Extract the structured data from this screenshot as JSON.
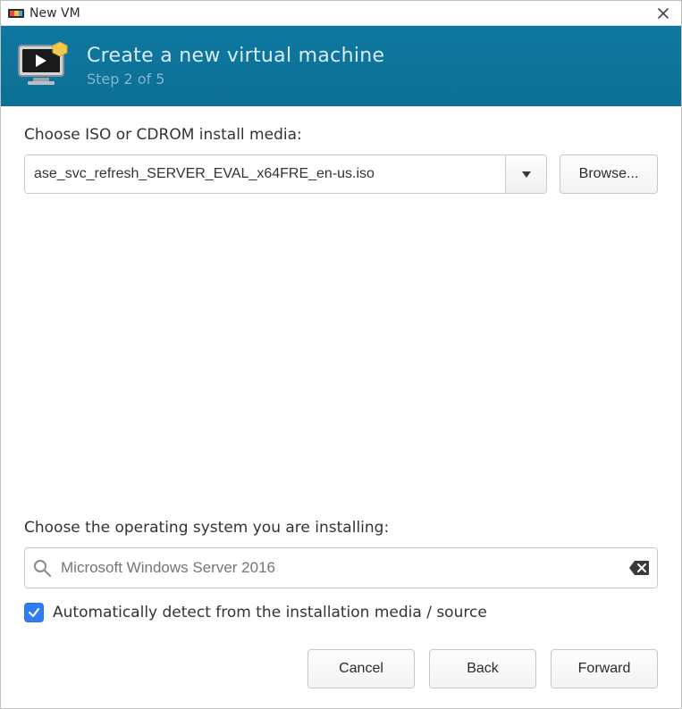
{
  "window": {
    "title": "New VM"
  },
  "banner": {
    "title": "Create a new virtual machine",
    "step": "Step 2 of 5"
  },
  "media": {
    "label": "Choose ISO or CDROM install media:",
    "value": "ase_svc_refresh_SERVER_EVAL_x64FRE_en-us.iso",
    "browse": "Browse..."
  },
  "os": {
    "label": "Choose the operating system you are installing:",
    "placeholder": "Microsoft Windows Server 2016",
    "value": ""
  },
  "autodetect": {
    "checked": true,
    "label": "Automatically detect from the installation media / source"
  },
  "buttons": {
    "cancel": "Cancel",
    "back": "Back",
    "forward": "Forward"
  },
  "colors": {
    "banner_bg": "#0f78a0",
    "accent_blue": "#2e7cf6"
  }
}
